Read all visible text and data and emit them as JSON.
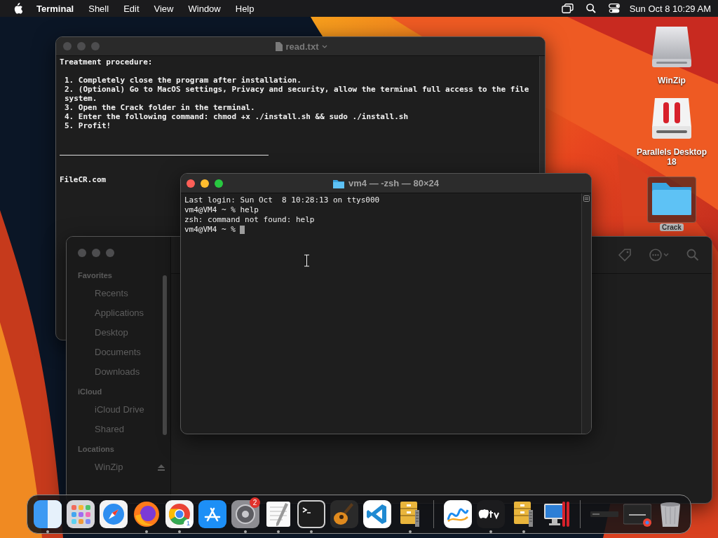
{
  "menubar": {
    "app_name": "Terminal",
    "menus": [
      "Shell",
      "Edit",
      "View",
      "Window",
      "Help"
    ],
    "clock": "Sun Oct 8  10:29 AM"
  },
  "text_window": {
    "title": "read.txt",
    "focused": false,
    "heading": "Treatment procedure:",
    "steps": [
      "1. Completely close the program after installation.",
      "2. (Optional) Go to MacOS settings, Privacy and security, allow the terminal full access to the file system.",
      "3. Open the Crack folder in the terminal.",
      "4. Enter the following command: chmod +x ./install.sh && sudo ./install.sh",
      "5. Profit!"
    ],
    "footer": "FileCR.com"
  },
  "finder": {
    "focused": false,
    "sections": [
      {
        "title": "Favorites",
        "items": [
          {
            "label": "Recents",
            "selected": false
          },
          {
            "label": "Applications",
            "selected": false
          },
          {
            "label": "Desktop",
            "selected": false
          },
          {
            "label": "Documents",
            "selected": false
          },
          {
            "label": "Downloads",
            "selected": false
          }
        ]
      },
      {
        "title": "iCloud",
        "items": [
          {
            "label": "iCloud Drive",
            "selected": false
          },
          {
            "label": "Shared",
            "selected": false
          }
        ]
      },
      {
        "title": "Locations",
        "items": [
          {
            "label": "WinZip",
            "selected": false,
            "ejectable": true
          }
        ]
      }
    ]
  },
  "terminal": {
    "title": "vm4 — -zsh — 80×24",
    "focused": true,
    "lines": [
      "Last login: Sun Oct  8 10:28:13 on ttys000",
      "vm4@VM4 ~ % help",
      "zsh: command not found: help"
    ],
    "prompt": "vm4@VM4 ~ % "
  },
  "desktop_icons": [
    {
      "kind": "drive",
      "label": "WinZip"
    },
    {
      "kind": "parallels",
      "label": "Parallels Desktop 18"
    },
    {
      "kind": "folder",
      "label": "Crack",
      "selected": true
    }
  ],
  "dock": {
    "items": [
      {
        "kind": "finder",
        "running": true
      },
      {
        "kind": "launchpad",
        "running": false
      },
      {
        "kind": "safari",
        "running": false
      },
      {
        "kind": "firefox",
        "running": true
      },
      {
        "kind": "chrome",
        "running": true,
        "badge": "1"
      },
      {
        "kind": "appstore",
        "running": false
      },
      {
        "kind": "settings",
        "running": true,
        "badge": "2"
      },
      {
        "kind": "textedit",
        "running": true
      },
      {
        "kind": "terminal",
        "running": true
      },
      {
        "kind": "garageband",
        "running": false
      },
      {
        "kind": "vscode",
        "running": false
      },
      {
        "kind": "archive",
        "running": true
      },
      {
        "kind": "separator"
      },
      {
        "kind": "freeform",
        "running": false
      },
      {
        "kind": "appletv",
        "running": true
      },
      {
        "kind": "archive",
        "running": true
      },
      {
        "kind": "parallels",
        "running": false
      },
      {
        "kind": "separator"
      },
      {
        "kind": "window",
        "running": false
      },
      {
        "kind": "chromewindow",
        "running": false
      },
      {
        "kind": "trash",
        "running": false
      }
    ]
  }
}
